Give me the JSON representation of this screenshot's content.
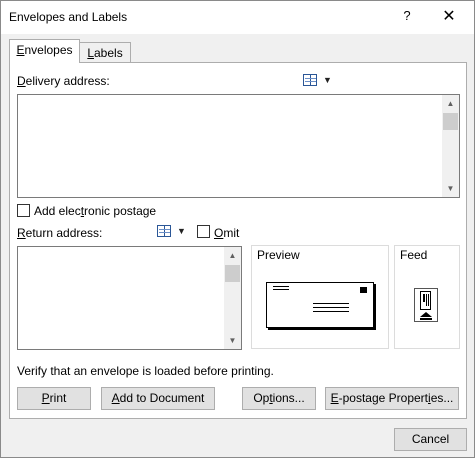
{
  "window": {
    "title": "Envelopes and Labels",
    "help_label": "?",
    "close_label": "✕"
  },
  "tabs": [
    {
      "label_first": "E",
      "label_rest": "nvelopes",
      "active": true
    },
    {
      "label_first": "L",
      "label_rest": "abels",
      "active": false
    }
  ],
  "delivery": {
    "label_first": "D",
    "label_rest": "elivery address:",
    "value": ""
  },
  "electronic_postage": {
    "label_pre": "Add elec",
    "label_u": "t",
    "label_post": "ronic postage",
    "checked": false
  },
  "return": {
    "label_first": "R",
    "label_rest": "eturn address:",
    "value": "",
    "omit_first": "O",
    "omit_rest": "mit",
    "omit_checked": false
  },
  "preview": {
    "title": "Preview"
  },
  "feed": {
    "title": "Feed"
  },
  "message": "Verify that an envelope is loaded before printing.",
  "buttons": {
    "print_first": "P",
    "print_rest": "rint",
    "add_first": "A",
    "add_rest": "dd to Document",
    "options_pre": "Op",
    "options_u": "t",
    "options_post": "ions...",
    "epost_first": "E",
    "epost_mid": "-postage Propert",
    "epost_u": "i",
    "epost_post": "es...",
    "cancel": "Cancel"
  },
  "icons": {
    "address_book": "address-book-icon",
    "dropdown": "chevron-down-icon",
    "scroll_up": "scroll-up-arrow-icon",
    "scroll_down": "scroll-down-arrow-icon"
  }
}
